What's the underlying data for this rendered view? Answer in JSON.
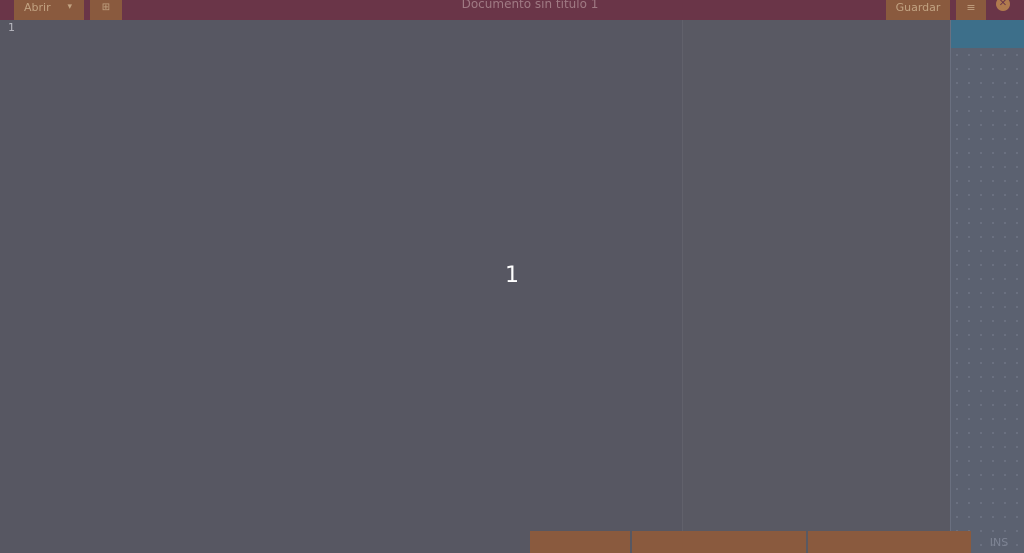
{
  "header": {
    "open_label": "Abrir",
    "open_chevron": "▾",
    "new_tab_icon": "⊞",
    "title": "Documento sin título 1",
    "save_label": "Guardar",
    "menu_icon": "≡",
    "close_icon": "✕"
  },
  "editor": {
    "line_number": "1",
    "overlay_number": "1"
  },
  "statusbar": {
    "insert_mode": "INS"
  }
}
